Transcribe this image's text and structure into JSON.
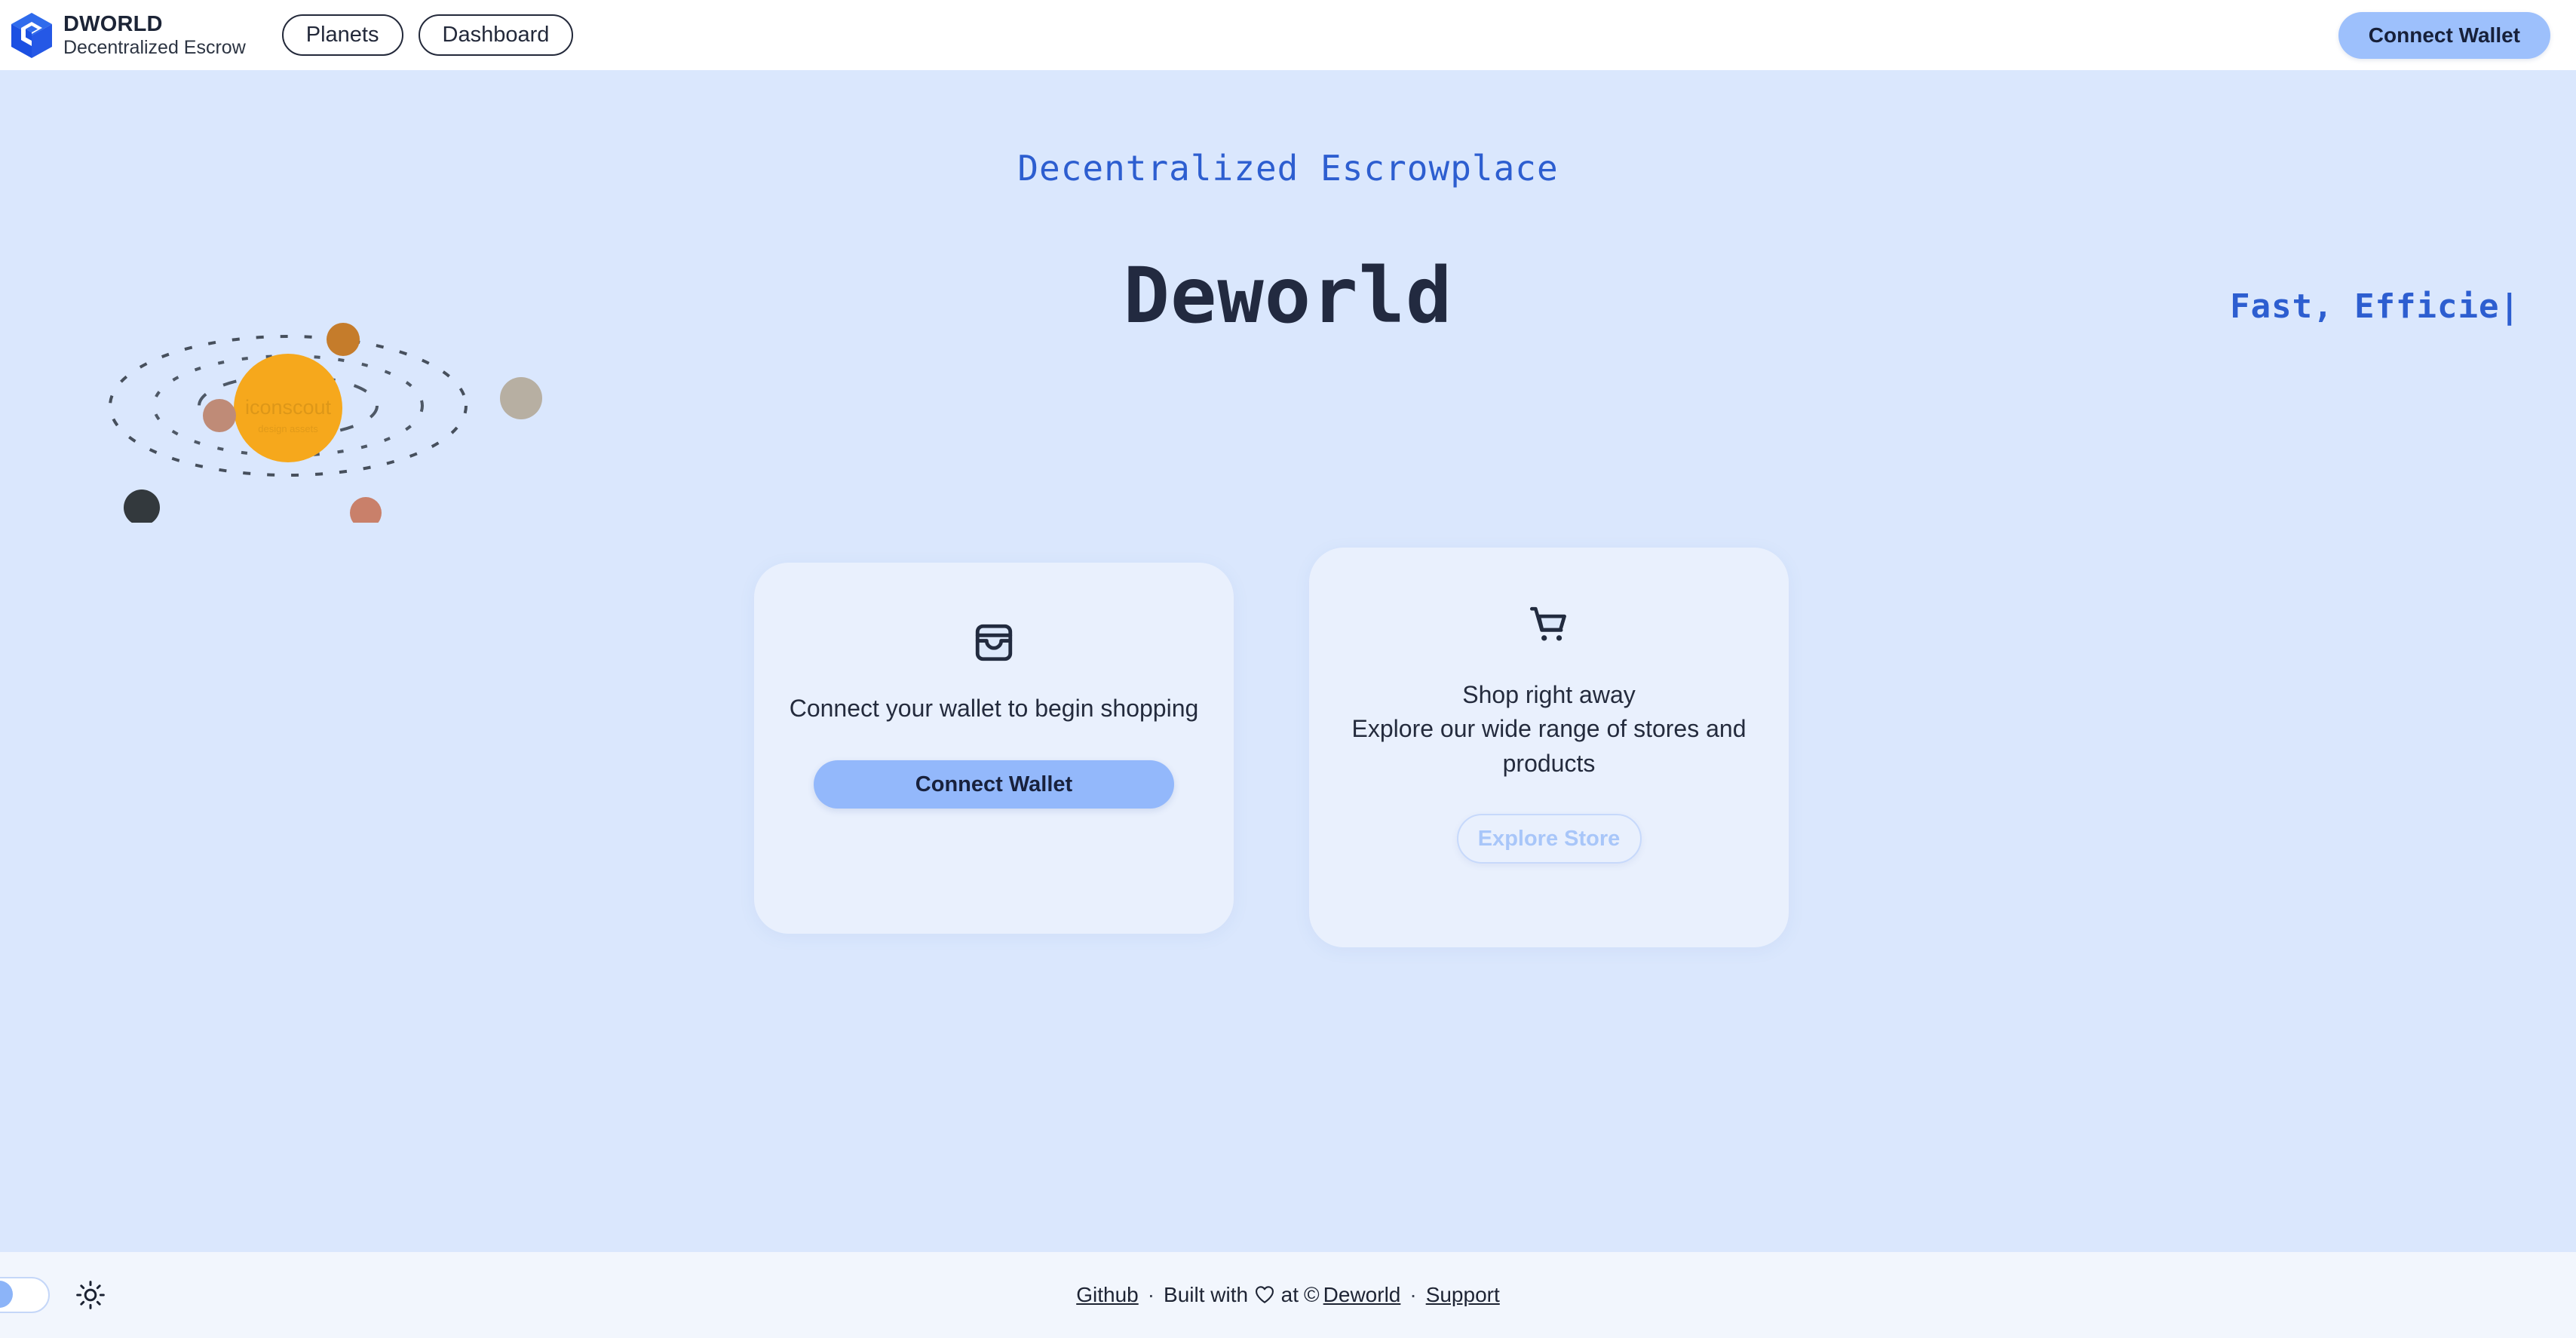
{
  "header": {
    "brand": {
      "logo_icon": "cube-logo-icon",
      "title": "DWORLD",
      "subtitle": "Decentralized Escrow",
      "logo_color": "#1b50e2"
    },
    "nav": [
      {
        "label": "Planets",
        "name": "nav-pill-planets"
      },
      {
        "label": "Dashboard",
        "name": "nav-pill-dashboard"
      }
    ],
    "connect_wallet_label": "Connect Wallet",
    "connect_wallet_color": "#9dc0fc",
    "background": "#ffffff"
  },
  "hero": {
    "background": "#dae7fd",
    "eyebrow": "Decentralized Escrowplace",
    "eyebrow_color": "#2d5ed0",
    "title": "Deworld",
    "title_color": "#222a40",
    "typewriter_text": "Fast, Efficie",
    "typewriter_caret": "|",
    "illustration": {
      "name": "solar-system-illustration",
      "sun_color": "#f6a81c",
      "watermark": "iconscout",
      "planets": [
        {
          "name": "planet-orange-top",
          "color": "#c57c2b"
        },
        {
          "name": "planet-beige-right",
          "color": "#b7afa2"
        },
        {
          "name": "planet-rose-left",
          "color": "#bf8b77"
        },
        {
          "name": "planet-dark-bottom-left",
          "color": "#33393d"
        },
        {
          "name": "planet-salmon-bottom",
          "color": "#c9806a"
        }
      ]
    }
  },
  "cards": [
    {
      "name": "card-connect-wallet",
      "icon": "wallet-inbox-icon",
      "text": "Connect your wallet to begin shopping",
      "button": {
        "label": "Connect Wallet",
        "style": "primary",
        "color": "#93b8fb"
      }
    },
    {
      "name": "card-shop",
      "icon": "shopping-cart-icon",
      "text": "Shop right away\nExplore our wide range of stores and products",
      "text_line1": "Shop right away",
      "text_line2": "Explore our wide range of stores and products",
      "button": {
        "label": "Explore Store",
        "style": "ghost",
        "color": "#a8c6f9"
      }
    }
  ],
  "footer": {
    "background": "#f2f6fd",
    "theme_toggle": {
      "name": "theme-toggle",
      "state": "off",
      "knob_color": "#8cb4f8"
    },
    "theme_icon": "sun-icon",
    "links": {
      "github": "Github",
      "built_with_prefix": "Built with",
      "heart_icon": "heart-icon",
      "at": "at",
      "copyright_glyph": "©",
      "deworld": "Deworld",
      "support": "Support"
    },
    "separator": "·"
  }
}
